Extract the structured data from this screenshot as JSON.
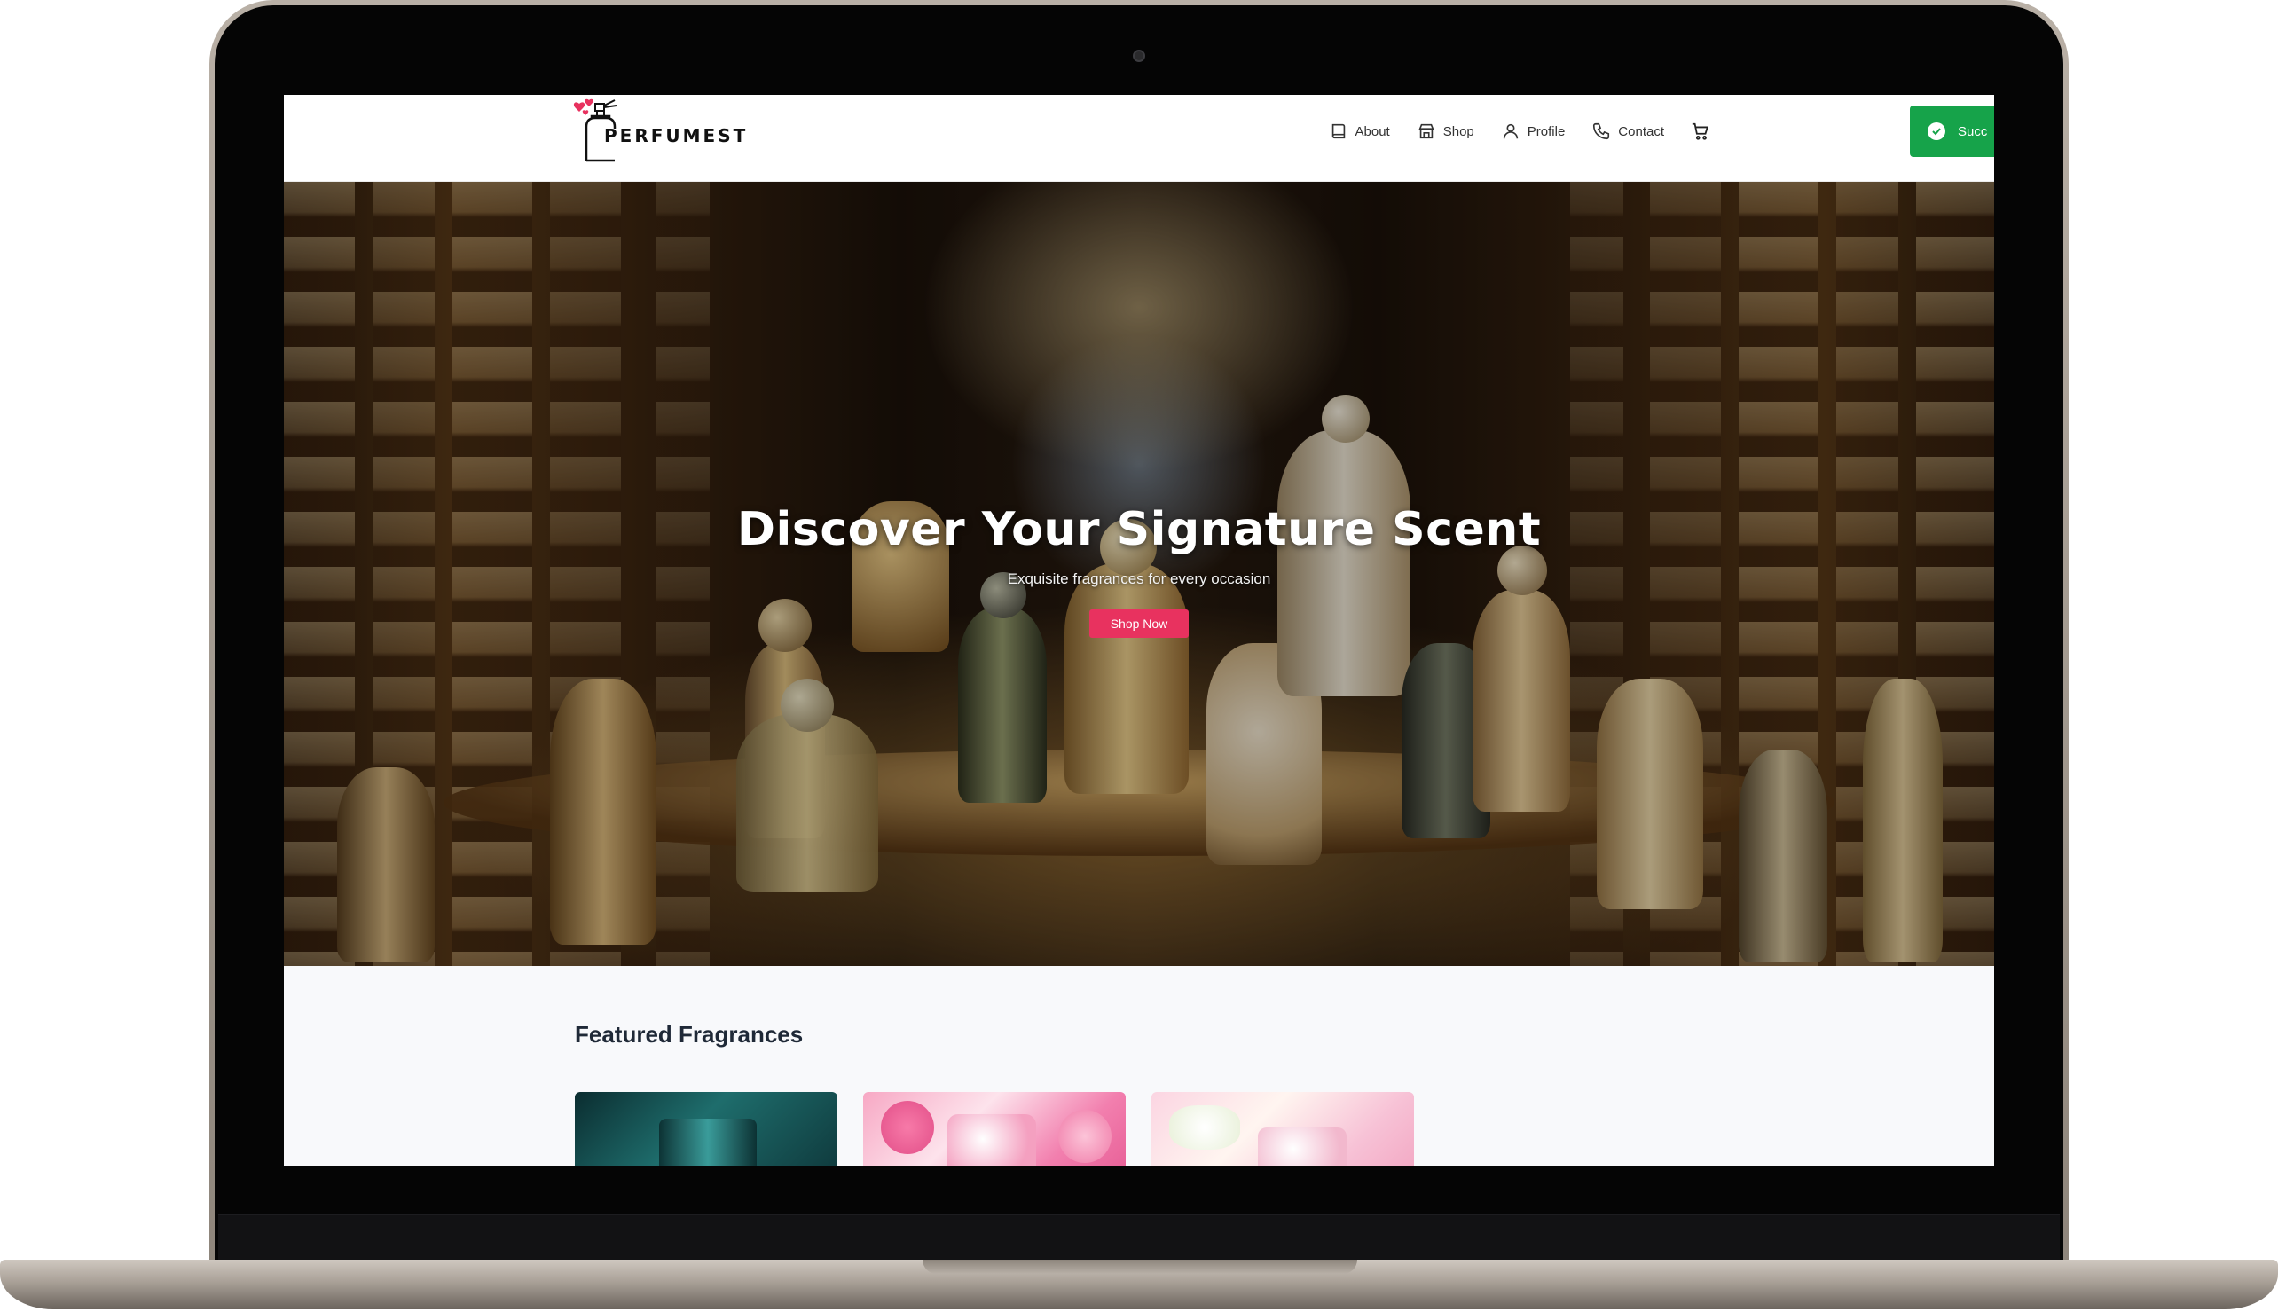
{
  "brand": {
    "name": "PERFUMEST"
  },
  "nav": {
    "items": [
      {
        "label": "About",
        "icon": "book-icon"
      },
      {
        "label": "Shop",
        "icon": "store-icon"
      },
      {
        "label": "Profile",
        "icon": "user-icon"
      },
      {
        "label": "Contact",
        "icon": "phone-icon"
      }
    ],
    "cart_icon": "cart-icon"
  },
  "toast": {
    "text": "Succ",
    "icon": "check-circle-icon",
    "color": "#16a34a"
  },
  "hero": {
    "title": "Discover Your Signature Scent",
    "subtitle": "Exquisite fragrances for every occasion",
    "cta_label": "Shop Now",
    "cta_color": "#e8325f"
  },
  "featured": {
    "title": "Featured Fragrances",
    "cards": [
      {
        "name": "product-card-1"
      },
      {
        "name": "product-card-2"
      },
      {
        "name": "product-card-3"
      }
    ]
  },
  "colors": {
    "accent": "#e8325f",
    "logo_heart": "#e8325f"
  }
}
